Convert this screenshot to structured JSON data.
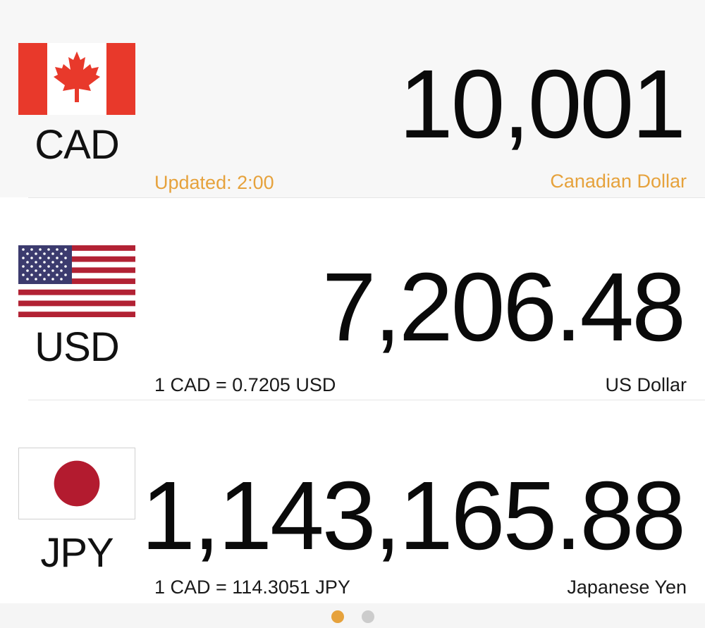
{
  "rows": [
    {
      "code": "CAD",
      "amount": "10,001",
      "left_text": "Updated: 2:00",
      "name": "Canadian Dollar",
      "flag_icon": "canada-flag-icon"
    },
    {
      "code": "USD",
      "amount": "7,206.48",
      "left_text": "1 CAD = 0.7205 USD",
      "name": "US Dollar",
      "flag_icon": "usa-flag-icon"
    },
    {
      "code": "JPY",
      "amount": "1,143,165.88",
      "left_text": "1 CAD = 114.3051 JPY",
      "name": "Japanese Yen",
      "flag_icon": "japan-flag-icon"
    }
  ],
  "pager": {
    "pages": 2,
    "current": 1
  },
  "colors": {
    "accent": "#e6a23c",
    "base_row_bg": "#f7f7f7",
    "page_dot_active": "#e6a23c",
    "page_dot_inactive": "#cccccc",
    "canada_red": "#e8392b",
    "usa_red": "#b22234",
    "usa_blue": "#3c3b6e",
    "japan_red": "#b31b2f"
  }
}
